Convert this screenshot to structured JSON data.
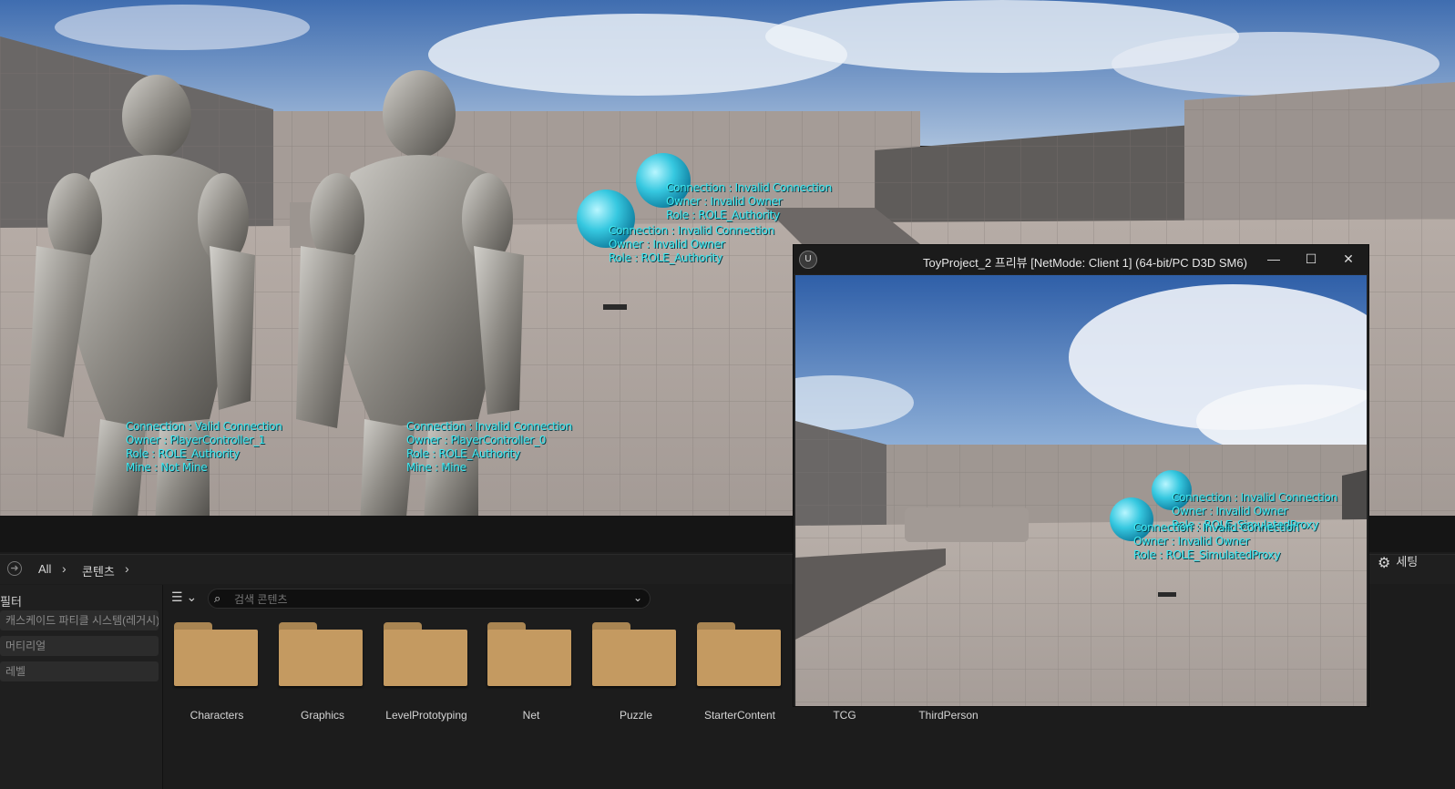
{
  "viewport": {
    "labels": [
      {
        "id": "sphere-a",
        "lines": [
          "Connection : Invalid Connection",
          "Owner : Invalid Owner",
          "Role : ROLE_Authority"
        ]
      },
      {
        "id": "sphere-b",
        "lines": [
          "Connection : Invalid Connection",
          "Owner : Invalid Owner",
          "Role : ROLE_Authority"
        ]
      },
      {
        "id": "char-1",
        "lines": [
          "Connection : Valid Connection",
          "Owner : PlayerController_1",
          "Role : ROLE_Authority",
          "Mine : Not Mine"
        ]
      },
      {
        "id": "char-0",
        "lines": [
          "Connection : Invalid Connection",
          "Owner : PlayerController_0",
          "Role : ROLE_Authority",
          "Mine : Mine"
        ]
      }
    ]
  },
  "pie": {
    "title": "ToyProject_2 프리뷰 [NetMode: Client 1]  (64-bit/PC D3D SM6)",
    "minimize": "—",
    "maximize": "☐",
    "close": "✕",
    "labels": [
      {
        "id": "pie-sphere-a",
        "lines": [
          "Connection : Invalid Connection",
          "Owner : Invalid Owner",
          "Role : ROLE_SimulatedProxy"
        ]
      },
      {
        "id": "pie-sphere-b",
        "lines": [
          "Connection : Invalid Connection",
          "Owner : Invalid Owner",
          "Role : ROLE_SimulatedProxy"
        ]
      }
    ]
  },
  "browser": {
    "breadcrumb": [
      "All",
      "콘텐츠"
    ],
    "filter_title": "필터",
    "filters": [
      "캐스케이드 파티클 시스템(레거시)",
      "머티리얼",
      "레벨"
    ],
    "search_placeholder": "검색 콘텐츠",
    "settings_label": "세팅",
    "folders": [
      "Characters",
      "Graphics",
      "LevelPrototyping",
      "Net",
      "Puzzle",
      "StarterContent",
      "TCG",
      "ThirdPerson"
    ]
  },
  "colors": {
    "debug_text": "#3ee8f0",
    "folder": "#c49a61",
    "sphere": "#36c8e0"
  }
}
